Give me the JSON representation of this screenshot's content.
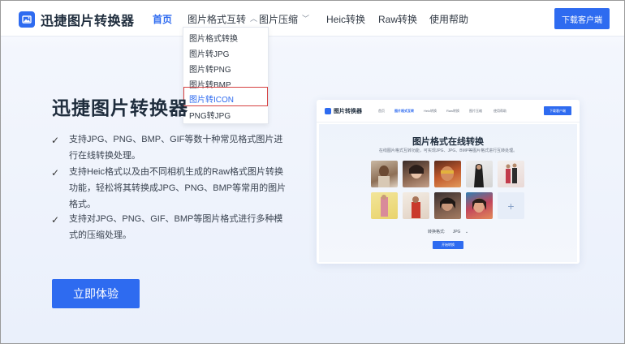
{
  "header": {
    "app_name": "迅捷图片转换器",
    "nav": [
      {
        "label": "首页",
        "active": true,
        "has_dropdown": false
      },
      {
        "label": "图片格式互转",
        "active": false,
        "has_dropdown": true
      },
      {
        "label": "图片压缩",
        "active": false,
        "has_dropdown": true
      },
      {
        "label": "Heic转换",
        "active": false,
        "has_dropdown": false
      },
      {
        "label": "Raw转换",
        "active": false,
        "has_dropdown": false
      },
      {
        "label": "使用帮助",
        "active": false,
        "has_dropdown": false
      }
    ],
    "download_label": "下载客户端"
  },
  "dropdown": {
    "items": [
      {
        "label": "图片格式转换"
      },
      {
        "label": "图片转JPG"
      },
      {
        "label": "图片转PNG"
      },
      {
        "label": "图片转BMP"
      },
      {
        "label": "图片转ICON",
        "highlighted": true
      },
      {
        "label": "PNG转JPG"
      }
    ]
  },
  "hero": {
    "title": "迅捷图片转换器",
    "features": [
      "支持JPG、PNG、BMP、GIF等数十种常见格式图片进行在线转换处理。",
      "支持Heic格式以及由不同相机生成的Raw格式图片转换功能，轻松将其转换成JPG、PNG、BMP等常用的图片格式。",
      "支持对JPG、PNG、GIF、BMP等图片格式进行多种模式的压缩处理。"
    ],
    "cta_label": "立即体验"
  },
  "preview": {
    "app_name": "图片转换器",
    "nav": [
      "首页",
      "图片格式互转",
      "Heic转换",
      "Raw转换",
      "图片压缩",
      "使用帮助"
    ],
    "download_label": "下载客户端",
    "title": "图片格式在线转换",
    "subtitle": "在线图片格式互转功能，可实现JPG、JPG、BMP等图片格式进行互转处理。",
    "format_label": "转换格式:",
    "format_value": "JPG",
    "start_label": "开始转换",
    "plus_icon": "+"
  },
  "colors": {
    "accent": "#2e6bf0",
    "highlight_border": "#d64040"
  }
}
